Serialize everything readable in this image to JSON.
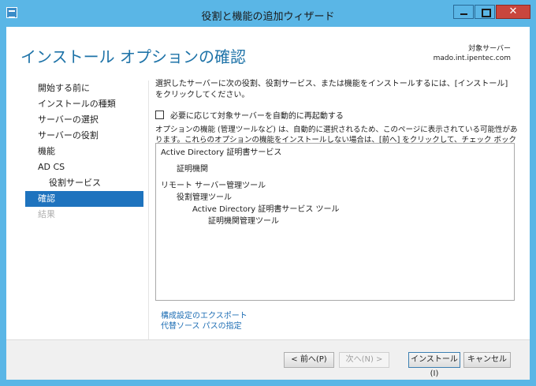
{
  "window": {
    "title": "役割と機能の追加ウィザード",
    "close_glyph": "✕"
  },
  "header": {
    "page_title": "インストール オプションの確認",
    "target_label": "対象サーバー",
    "target_server": "mado.int.ipentec.com"
  },
  "sidebar": {
    "items": [
      {
        "label": "開始する前に"
      },
      {
        "label": "インストールの種類"
      },
      {
        "label": "サーバーの選択"
      },
      {
        "label": "サーバーの役割"
      },
      {
        "label": "機能"
      },
      {
        "label": "AD CS"
      },
      {
        "label": "役割サービス"
      },
      {
        "label": "確認"
      },
      {
        "label": "結果"
      }
    ]
  },
  "main": {
    "description": "選択したサーバーに次の役割、役割サービス、または機能をインストールするには、[インストール] をクリックしてください。",
    "restart_checkbox_label": "必要に応じて対象サーバーを自動的に再起動する",
    "note": "オプションの機能 (管理ツールなど) は、自動的に選択されるため、このページに表示されている可能性があります。これらのオプションの機能をインストールしない場合は、[前へ] をクリックして、チェック ボックスをオフにしてください。",
    "features": [
      {
        "label": "Active Directory 証明書サービス",
        "level": 0
      },
      {
        "label": "証明機関",
        "level": 1
      },
      {
        "label": "リモート サーバー管理ツール",
        "level": 0
      },
      {
        "label": "役割管理ツール",
        "level": 1
      },
      {
        "label": "Active Directory 証明書サービス ツール",
        "level": 2
      },
      {
        "label": "証明機関管理ツール",
        "level": 3
      }
    ],
    "links": {
      "export": "構成設定のエクスポート",
      "alt_source": "代替ソース パスの指定"
    }
  },
  "footer": {
    "prev": "< 前へ(P)",
    "next": "次へ(N) >",
    "install": "インストール(I)",
    "cancel": "キャンセル"
  }
}
